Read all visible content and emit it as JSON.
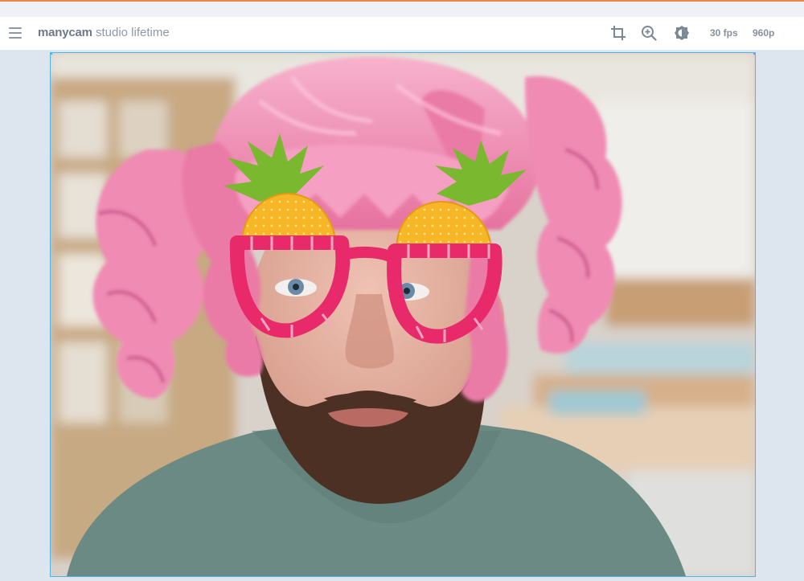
{
  "app": {
    "brand": "manycam",
    "product": "studio lifetime"
  },
  "toolbar": {
    "icons": [
      "menu-icon",
      "crop-icon",
      "zoom-icon",
      "brightness-icon"
    ],
    "fps": "30 fps",
    "resolution": "960p"
  },
  "preview": {
    "effects": [
      "pink-curly-wig",
      "pineapple-glasses"
    ]
  },
  "colors": {
    "accent": "#4fb3e6",
    "wig": "#f08bb3",
    "glasses": "#e8296a",
    "pineapple": "#f6b625",
    "leaves": "#7ab82f",
    "shirt": "#6b8a84"
  }
}
